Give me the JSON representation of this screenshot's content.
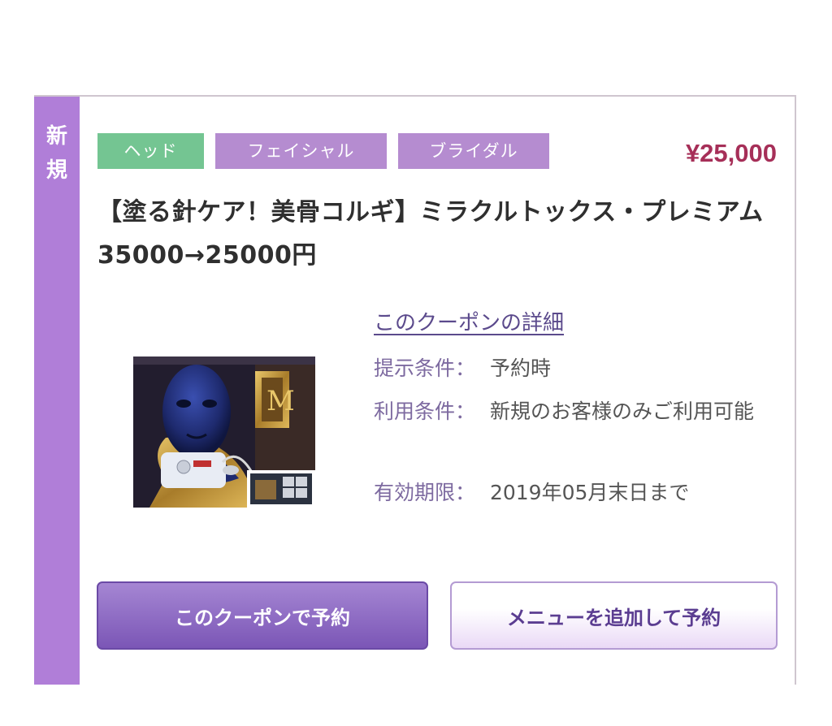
{
  "card": {
    "side_label": [
      "新",
      "規"
    ],
    "tags": [
      {
        "label": "ヘッド",
        "color": "#74c592"
      },
      {
        "label": "フェイシャル",
        "color": "#b58cd0"
      },
      {
        "label": "ブライダル",
        "color": "#b58cd0"
      }
    ],
    "price": "¥25,000",
    "title": "【塗る針ケア！美骨コルギ】ミラクルトックス・プレミアム35000→25000円",
    "detail_link": "このクーポンの詳細",
    "conditions": [
      {
        "label": "提示条件：",
        "value": "予約時"
      },
      {
        "label": "利用条件：",
        "value": "新規のお客様のみご利用可能"
      },
      {
        "label": "有効期限：",
        "value": "2019年05月末日まで"
      }
    ],
    "buttons": {
      "book_coupon": "このクーポンで予約",
      "add_menu": "メニューを追加して予約"
    }
  }
}
